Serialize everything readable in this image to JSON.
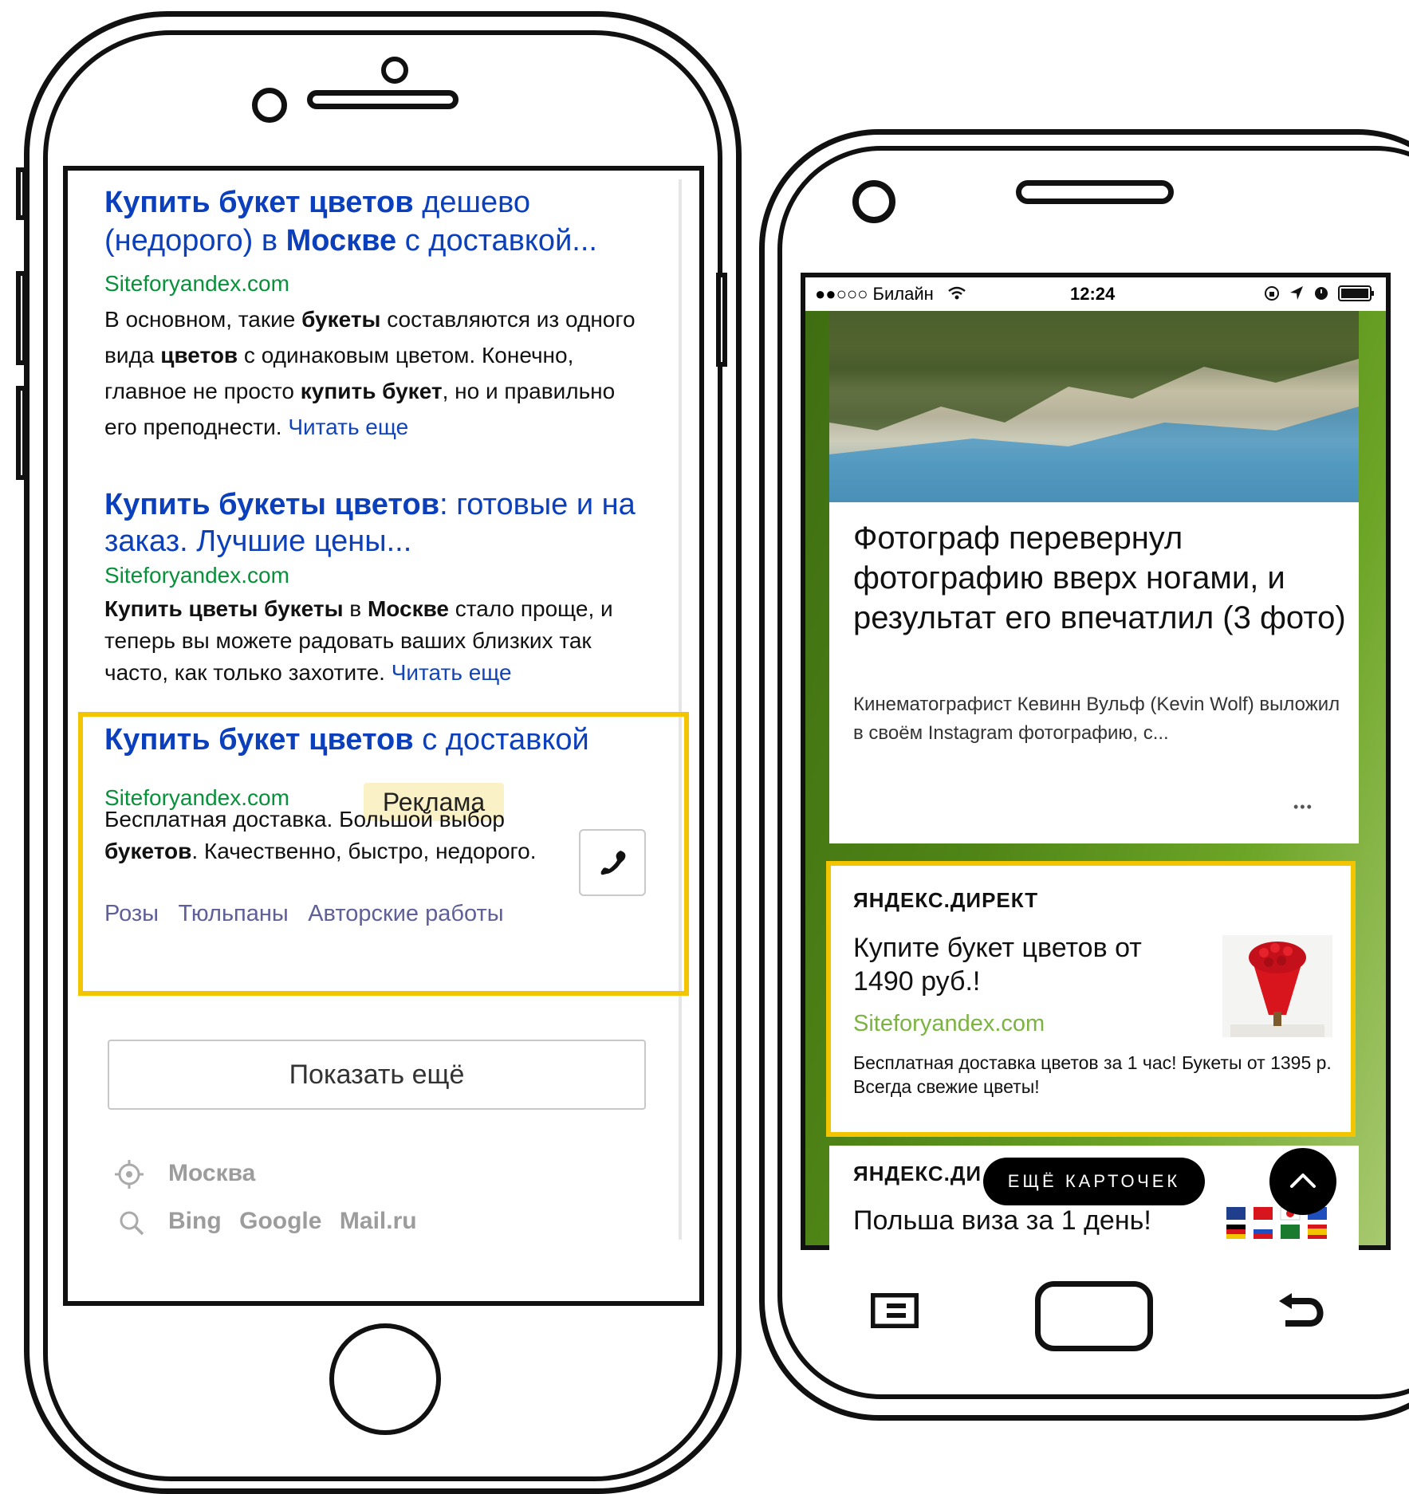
{
  "left_phone": {
    "results": [
      {
        "title_parts": [
          {
            "text": "Купить букет цветов",
            "bold": true
          },
          {
            "text": " дешево (недорого) в ",
            "bold": false
          },
          {
            "text": "Москве",
            "bold": true
          },
          {
            "text": " с доставкой...",
            "bold": false
          }
        ],
        "url": "Siteforyandex.com",
        "text_parts": [
          {
            "text": "В основном, такие ",
            "bold": false
          },
          {
            "text": "букеты",
            "bold": true
          },
          {
            "text": " составляются из одного вида ",
            "bold": false
          },
          {
            "text": "цветов",
            "bold": true
          },
          {
            "text": " с одинаковым цветом. Конечно, главное не просто ",
            "bold": false
          },
          {
            "text": "купить букет",
            "bold": true
          },
          {
            "text": ", но и правильно его преподнести. ",
            "bold": false
          }
        ],
        "read_more": "Читать еще"
      },
      {
        "title_parts": [
          {
            "text": "Купить букеты цветов",
            "bold": true
          },
          {
            "text": ": готовые и на заказ. Лучшие цены...",
            "bold": false
          }
        ],
        "url": "Siteforyandex.com",
        "text_parts": [
          {
            "text": "Купить цветы букеты",
            "bold": true
          },
          {
            "text": " в ",
            "bold": false
          },
          {
            "text": "Москве",
            "bold": true
          },
          {
            "text": " стало проще, и теперь вы можете радовать ваших близких так часто, как только захотите. ",
            "bold": false
          }
        ],
        "read_more": "Читать еще"
      }
    ],
    "ad": {
      "title_bold": "Купить букет цветов",
      "title_rest": " с доставкой",
      "url": "Siteforyandex.com",
      "badge": "Реклама",
      "text_parts": [
        {
          "text": "Бесплатная доставка. Большой выбор ",
          "bold": false
        },
        {
          "text": "букетов",
          "bold": true
        },
        {
          "text": ". Качественно, быстро, недорого.",
          "bold": false
        }
      ],
      "sitelinks": [
        "Розы",
        "Тюльпаны",
        "Авторские работы"
      ]
    },
    "show_more": "Показать ещё",
    "region": "Москва",
    "engines": [
      "Bing",
      "Google",
      "Mail.ru"
    ]
  },
  "right_phone": {
    "status": {
      "carrier": "●●○○○ Билайн",
      "time": "12:24"
    },
    "article": {
      "title": "Фотограф перевернул фотографию вверх ногами, и результат его впечатлил (3 фото)",
      "desc": "Кинематографист Кевинн Вульф (Kevin Wolf) выложил в своём Instagram фотографию, с...",
      "more": "•••"
    },
    "direct_ad": {
      "label": "ЯНДЕКС.ДИРЕКТ",
      "title": "Купите букет цветов от 1490 руб.!",
      "url": "Siteforyandex.com",
      "text": "Бесплатная доставка цветов за 1 час! Букеты от 1395 р. Всегда свежие цветы!"
    },
    "direct_ad2": {
      "label": "ЯНДЕКС.ДИ",
      "title": "Польша виза за 1 день!"
    },
    "more_cards": "ЕЩЁ КАРТОЧЕК"
  },
  "colors": {
    "link": "#0b3fbb",
    "url_green": "#08913a",
    "ad_border": "#f3c400",
    "zen_green": "#6da527"
  }
}
